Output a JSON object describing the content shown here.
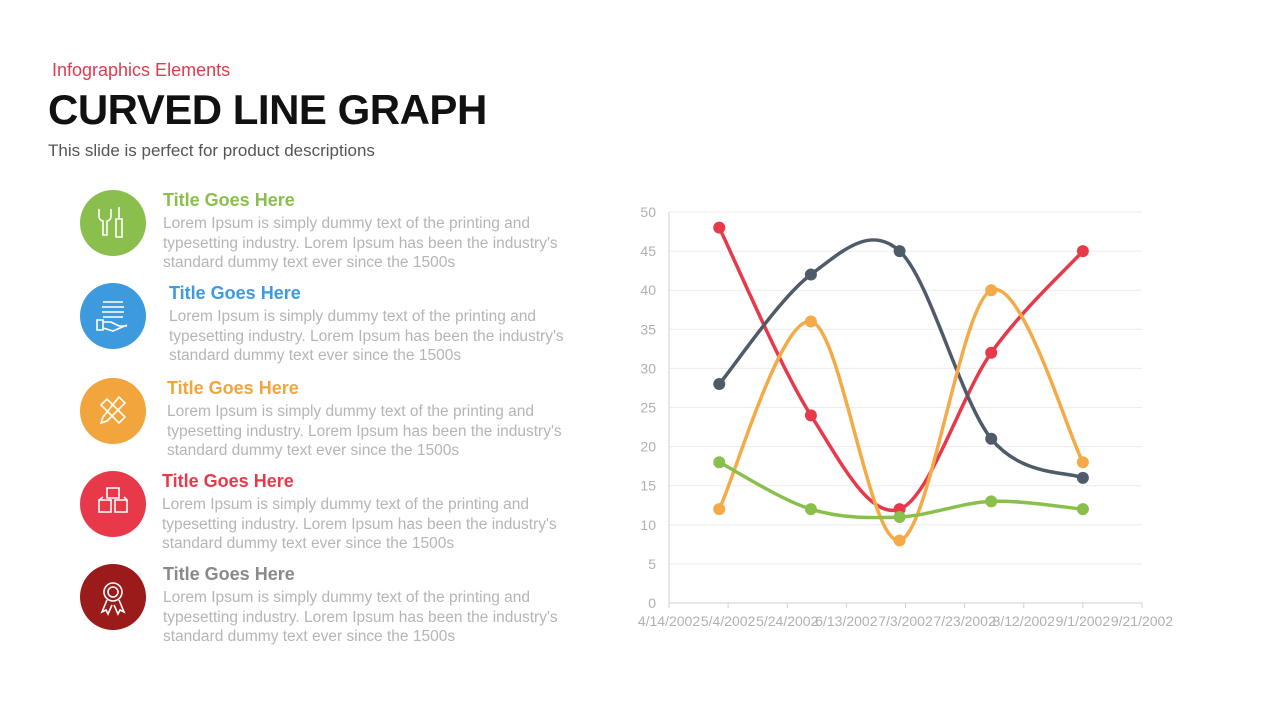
{
  "header": {
    "supertitle": "Infographics  Elements",
    "title": "CURVED LINE GRAPH",
    "subtitle": "This slide is perfect for product descriptions"
  },
  "items": [
    {
      "title": "Title Goes Here",
      "body": "Lorem Ipsum is simply dummy text of the printing and typesetting industry. Lorem Ipsum has been the industry's standard dummy text ever since the 1500s",
      "color": "#8BBF4D",
      "icon": "tools-icon"
    },
    {
      "title": "Title Goes Here",
      "body": "Lorem Ipsum is simply dummy text of the printing and typesetting industry. Lorem Ipsum has been the industry's standard dummy text ever since the 1500s",
      "color": "#3D9BDD",
      "icon": "hand-stack-icon"
    },
    {
      "title": "Title Goes Here",
      "body": "Lorem Ipsum is simply dummy text of the printing and typesetting industry. Lorem Ipsum has been the industry's standard dummy text ever since the 1500s",
      "color": "#F2A53C",
      "icon": "pencil-ruler-icon"
    },
    {
      "title": "Title Goes Here",
      "body": "Lorem Ipsum is simply dummy text of the printing and typesetting industry. Lorem Ipsum has been the industry's standard dummy text ever since the 1500s",
      "color": "#E8394A",
      "icon": "boxes-icon"
    },
    {
      "title": "Title Goes Here",
      "body": "Lorem Ipsum is simply dummy text of the printing and typesetting industry. Lorem Ipsum has been the industry's standard dummy text ever since the 1500s",
      "color": "#9B1B1B",
      "title_color": "#8a8a8a",
      "icon": "award-icon"
    }
  ],
  "chart_data": {
    "type": "line",
    "smooth": true,
    "grid": true,
    "x": [
      "5/1/2002",
      "6/1/2002",
      "7/1/2002",
      "8/1/2002",
      "9/1/2002"
    ],
    "xticks": [
      "4/14/2002",
      "5/4/2002",
      "5/24/2002",
      "6/13/2002",
      "7/3/2002",
      "7/23/2002",
      "8/12/2002",
      "9/1/2002",
      "9/21/2002"
    ],
    "ylim": [
      0,
      50
    ],
    "yticks": [
      0,
      5,
      10,
      15,
      20,
      25,
      30,
      35,
      40,
      45,
      50
    ],
    "series": [
      {
        "color": "#E8394A",
        "values": [
          48,
          24,
          12,
          32,
          45
        ]
      },
      {
        "color": "#4F5B69",
        "values": [
          28,
          42,
          45,
          21,
          16
        ]
      },
      {
        "color": "#F5AA48",
        "values": [
          12,
          36,
          8,
          40,
          18
        ]
      },
      {
        "color": "#8BBF4D",
        "values": [
          18,
          12,
          11,
          13,
          12
        ]
      }
    ]
  }
}
